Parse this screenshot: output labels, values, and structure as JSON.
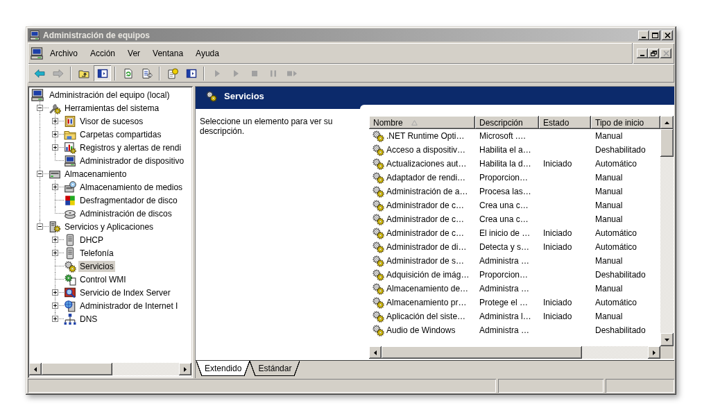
{
  "window": {
    "title": "Administración de equipos",
    "caption_buttons": [
      {
        "kind": "minimize",
        "disabled": false
      },
      {
        "kind": "maximize",
        "disabled": false
      },
      {
        "kind": "close",
        "disabled": false
      }
    ]
  },
  "menu_bar": {
    "items": [
      "Archivo",
      "Acción",
      "Ver",
      "Ventana",
      "Ayuda"
    ],
    "child_buttons": [
      {
        "kind": "minimize",
        "disabled": false
      },
      {
        "kind": "restore",
        "disabled": false
      },
      {
        "kind": "close",
        "disabled": true
      }
    ]
  },
  "toolbar": {
    "groups": [
      [
        {
          "disabled": false,
          "pressed": false
        },
        {
          "disabled": true,
          "pressed": false
        }
      ],
      [
        {
          "disabled": false,
          "pressed": false
        },
        {
          "disabled": false,
          "pressed": true
        }
      ],
      [
        {
          "disabled": false,
          "pressed": false
        },
        {
          "disabled": false,
          "pressed": false
        }
      ],
      [
        {
          "disabled": false,
          "pressed": false
        },
        {
          "disabled": false,
          "pressed": false
        }
      ],
      [
        {
          "disabled": true,
          "pressed": false
        },
        {
          "disabled": true,
          "pressed": false
        },
        {
          "disabled": true,
          "pressed": false
        },
        {
          "disabled": true,
          "pressed": false
        },
        {
          "disabled": true,
          "pressed": false
        }
      ]
    ]
  },
  "tree": {
    "items": [
      {
        "label": "Administración del equipo (local)",
        "selected": false,
        "children": [
          {
            "label": "Herramientas del sistema",
            "expanded": true,
            "selected": false,
            "children": [
              {
                "label": "Visor de sucesos",
                "expanded": false,
                "selected": false
              },
              {
                "label": "Carpetas compartidas",
                "expanded": false,
                "selected": false
              },
              {
                "label": "Registros y alertas de rendi",
                "expanded": false,
                "selected": false
              },
              {
                "label": "Administrador de dispositivo",
                "selected": false
              }
            ]
          },
          {
            "label": "Almacenamiento",
            "expanded": true,
            "selected": false,
            "children": [
              {
                "label": "Almacenamiento de medios",
                "expanded": false,
                "selected": false
              },
              {
                "label": "Desfragmentador de disco",
                "selected": false
              },
              {
                "label": "Administración de discos",
                "selected": false
              }
            ]
          },
          {
            "label": "Servicios y Aplicaciones",
            "expanded": true,
            "selected": false,
            "children": [
              {
                "label": "DHCP",
                "expanded": false,
                "selected": false
              },
              {
                "label": "Telefonía",
                "expanded": false,
                "selected": false
              },
              {
                "label": "Servicios",
                "selected": true
              },
              {
                "label": "Control WMI",
                "selected": false
              },
              {
                "label": "Servicio de Index Server",
                "expanded": false,
                "selected": false
              },
              {
                "label": "Administrador de Internet I",
                "expanded": false,
                "selected": false
              },
              {
                "label": "DNS",
                "expanded": false,
                "selected": false
              }
            ]
          }
        ]
      }
    ]
  },
  "details": {
    "title": "Servicios",
    "description": "Seleccione un elemento para ver su descripción.",
    "table": {
      "columns": [
        {
          "label": "Nombre",
          "sorted": true
        },
        {
          "label": "Descripción",
          "sorted": false
        },
        {
          "label": "Estado",
          "sorted": false
        },
        {
          "label": "Tipo de inicio",
          "sorted": false
        }
      ],
      "rows": [
        {
          "name": ".NET Runtime Opti…",
          "description": "Microsoft .…",
          "startup_type": "Manual",
          "selected": false
        },
        {
          "name": "Acceso a dispositiv…",
          "description": "Habilita el a…",
          "startup_type": "Deshabilitado",
          "selected": false
        },
        {
          "name": "Actualizaciones aut…",
          "description": "Habilita la d…",
          "status": "Iniciado",
          "startup_type": "Automático",
          "selected": false
        },
        {
          "name": "Adaptador de rendi…",
          "description": "Proporcion…",
          "startup_type": "Manual",
          "selected": false
        },
        {
          "name": "Administración de a…",
          "description": "Procesa las…",
          "startup_type": "Manual",
          "selected": false
        },
        {
          "name": "Administrador de c…",
          "description": "Crea una c…",
          "startup_type": "Manual",
          "selected": false
        },
        {
          "name": "Administrador de c…",
          "description": "Crea una c…",
          "startup_type": "Manual",
          "selected": false
        },
        {
          "name": "Administrador de c…",
          "description": "El inicio de …",
          "status": "Iniciado",
          "startup_type": "Automático",
          "selected": false
        },
        {
          "name": "Administrador de di…",
          "description": "Detecta y s…",
          "status": "Iniciado",
          "startup_type": "Automático",
          "selected": false
        },
        {
          "name": "Administrador de s…",
          "description": "Administra …",
          "startup_type": "Manual",
          "selected": false
        },
        {
          "name": "Adquisición de imág…",
          "description": "Proporcion…",
          "startup_type": "Deshabilitado",
          "selected": false
        },
        {
          "name": "Almacenamiento de…",
          "description": "Administra …",
          "startup_type": "Manual",
          "selected": false
        },
        {
          "name": "Almacenamiento pr…",
          "description": "Protege el …",
          "status": "Iniciado",
          "startup_type": "Automático",
          "selected": false
        },
        {
          "name": "Aplicación del siste…",
          "description": "Administra l…",
          "status": "Iniciado",
          "startup_type": "Manual",
          "selected": false
        },
        {
          "name": "Audio de Windows",
          "description": "Administra …",
          "startup_type": "Deshabilitado",
          "selected": false
        }
      ]
    },
    "view_tabs": [
      {
        "label": "Extendido",
        "selected": true
      },
      {
        "label": "Estándar",
        "selected": false
      }
    ]
  }
}
